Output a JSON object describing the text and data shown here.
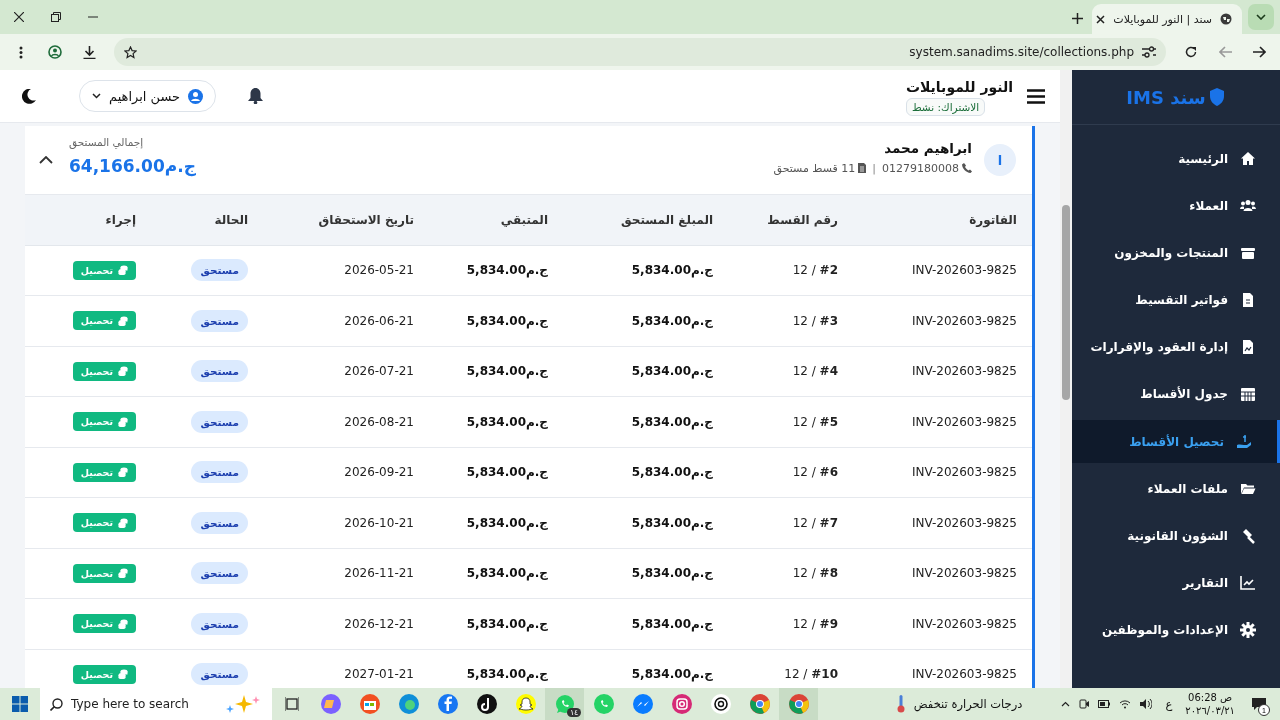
{
  "browser": {
    "tab_title": "سند | النور للموبايلات",
    "url": "system.sanadims.site/collections.php"
  },
  "header": {
    "store_name": "النور للموبايلات",
    "subscription": "الاشتراك: نشط",
    "user": "حسن ابراهيم"
  },
  "sidebar": {
    "brand": "سند IMS",
    "items": [
      {
        "label": "الرئيسية",
        "selected": false
      },
      {
        "label": "العملاء",
        "selected": false
      },
      {
        "label": "المنتجات والمخزون",
        "selected": false
      },
      {
        "label": "فواتير التقسيط",
        "selected": false
      },
      {
        "label": "إدارة العقود والإقرارات",
        "selected": false
      },
      {
        "label": "جدول الأقساط",
        "selected": false
      },
      {
        "label": "تحصيل الأقساط",
        "selected": true
      },
      {
        "label": "ملفات العملاء",
        "selected": false
      },
      {
        "label": "الشؤون القانونية",
        "selected": false
      },
      {
        "label": "التقارير",
        "selected": false
      },
      {
        "label": "الإعدادات والموظفين",
        "selected": false
      }
    ]
  },
  "customer": {
    "initial": "ا",
    "name": "ابراهيم محمد",
    "phone": "01279180008",
    "separator": "|",
    "due_count": "11 قسط مستحق",
    "total_label": "إجمالي المستحق",
    "total": "ج.م64,166.00",
    "expanded": true
  },
  "table": {
    "columns": [
      "الفاتورة",
      "رقم القسط",
      "المبلغ المستحق",
      "المتبقي",
      "تاريخ الاستحقاق",
      "الحالة",
      "إجراء"
    ],
    "rows": [
      {
        "invoice": "INV-202603-9825",
        "installment": "12 / **#2**",
        "amount": "ج.م5,834.00",
        "remaining": "ج.م5,834.00",
        "due_date": "2026-05-21",
        "status": "مستحق",
        "action": "تحصيل"
      },
      {
        "invoice": "INV-202603-9825",
        "installment": "12 / **#3**",
        "amount": "ج.م5,834.00",
        "remaining": "ج.م5,834.00",
        "due_date": "2026-06-21",
        "status": "مستحق",
        "action": "تحصيل"
      },
      {
        "invoice": "INV-202603-9825",
        "installment": "12 / **#4**",
        "amount": "ج.م5,834.00",
        "remaining": "ج.م5,834.00",
        "due_date": "2026-07-21",
        "status": "مستحق",
        "action": "تحصيل"
      },
      {
        "invoice": "INV-202603-9825",
        "installment": "12 / **#5**",
        "amount": "ج.م5,834.00",
        "remaining": "ج.م5,834.00",
        "due_date": "2026-08-21",
        "status": "مستحق",
        "action": "تحصيل"
      },
      {
        "invoice": "INV-202603-9825",
        "installment": "12 / **#6**",
        "amount": "ج.م5,834.00",
        "remaining": "ج.م5,834.00",
        "due_date": "2026-09-21",
        "status": "مستحق",
        "action": "تحصيل"
      },
      {
        "invoice": "INV-202603-9825",
        "installment": "12 / **#7**",
        "amount": "ج.م5,834.00",
        "remaining": "ج.م5,834.00",
        "due_date": "2026-10-21",
        "status": "مستحق",
        "action": "تحصيل"
      },
      {
        "invoice": "INV-202603-9825",
        "installment": "12 / **#8**",
        "amount": "ج.م5,834.00",
        "remaining": "ج.م5,834.00",
        "due_date": "2026-11-21",
        "status": "مستحق",
        "action": "تحصيل"
      },
      {
        "invoice": "INV-202603-9825",
        "installment": "12 / **#9**",
        "amount": "ج.م5,834.00",
        "remaining": "ج.م5,834.00",
        "due_date": "2026-12-21",
        "status": "مستحق",
        "action": "تحصيل"
      },
      {
        "invoice": "INV-202603-9825",
        "installment": "12 / **#10**",
        "amount": "ج.م5,834.00",
        "remaining": "ج.م5,834.00",
        "due_date": "2027-01-21",
        "status": "مستحق",
        "action": "تحصيل"
      }
    ]
  },
  "taskbar": {
    "search_placeholder": "Type here to search",
    "chat_badge": "١٤",
    "weather": "درجات الحرارة تنخفض",
    "language": "ع",
    "time": "06:28",
    "period": "ص",
    "date": "٢٠٢٦/٠٣/٢١",
    "notifications": "1"
  }
}
